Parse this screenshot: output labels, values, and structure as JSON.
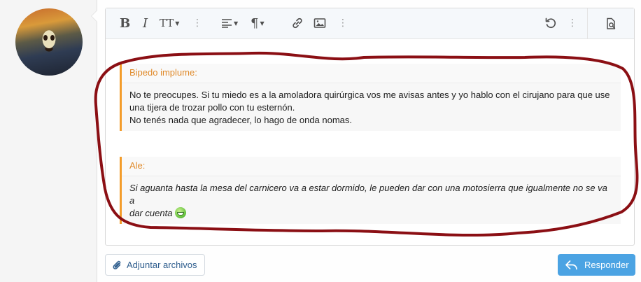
{
  "toolbar": {
    "icons": [
      "bold-icon",
      "italic-icon",
      "text-size-icon",
      "more-icon",
      "align-icon",
      "paragraph-icon",
      "link-icon",
      "image-icon",
      "more-icon",
      "undo-icon",
      "more-icon",
      "preview-icon"
    ],
    "bold_glyph": "B",
    "italic_glyph": "I",
    "text_size_glyph": "TT",
    "paragraph_glyph": "¶"
  },
  "quotes": [
    {
      "author": "Bipedo implume:",
      "lines": [
        "No te preocupes. Si tu miedo es a la amoladora quirúrgica vos me avisas antes y yo hablo con el cirujano para que use",
        "una tijera de trozar pollo con tu esternón.",
        "No tenés nada que agradecer, lo hago de onda nomas."
      ]
    },
    {
      "author": "Ale:",
      "lines": [
        "Si aguanta hasta la mesa del carnicero va a estar dormido, le pueden dar con una motosierra que igualmente no se va a",
        "dar cuenta"
      ],
      "emoji": "grin-emoji"
    }
  ],
  "buttons": {
    "attach_label": "Adjuntar archivos",
    "reply_label": "Responder"
  },
  "colors": {
    "accent": "#4ba3e3",
    "quote_border": "#f39c2a",
    "quote_author": "#e08a2a",
    "annotation": "#8b0f14"
  }
}
